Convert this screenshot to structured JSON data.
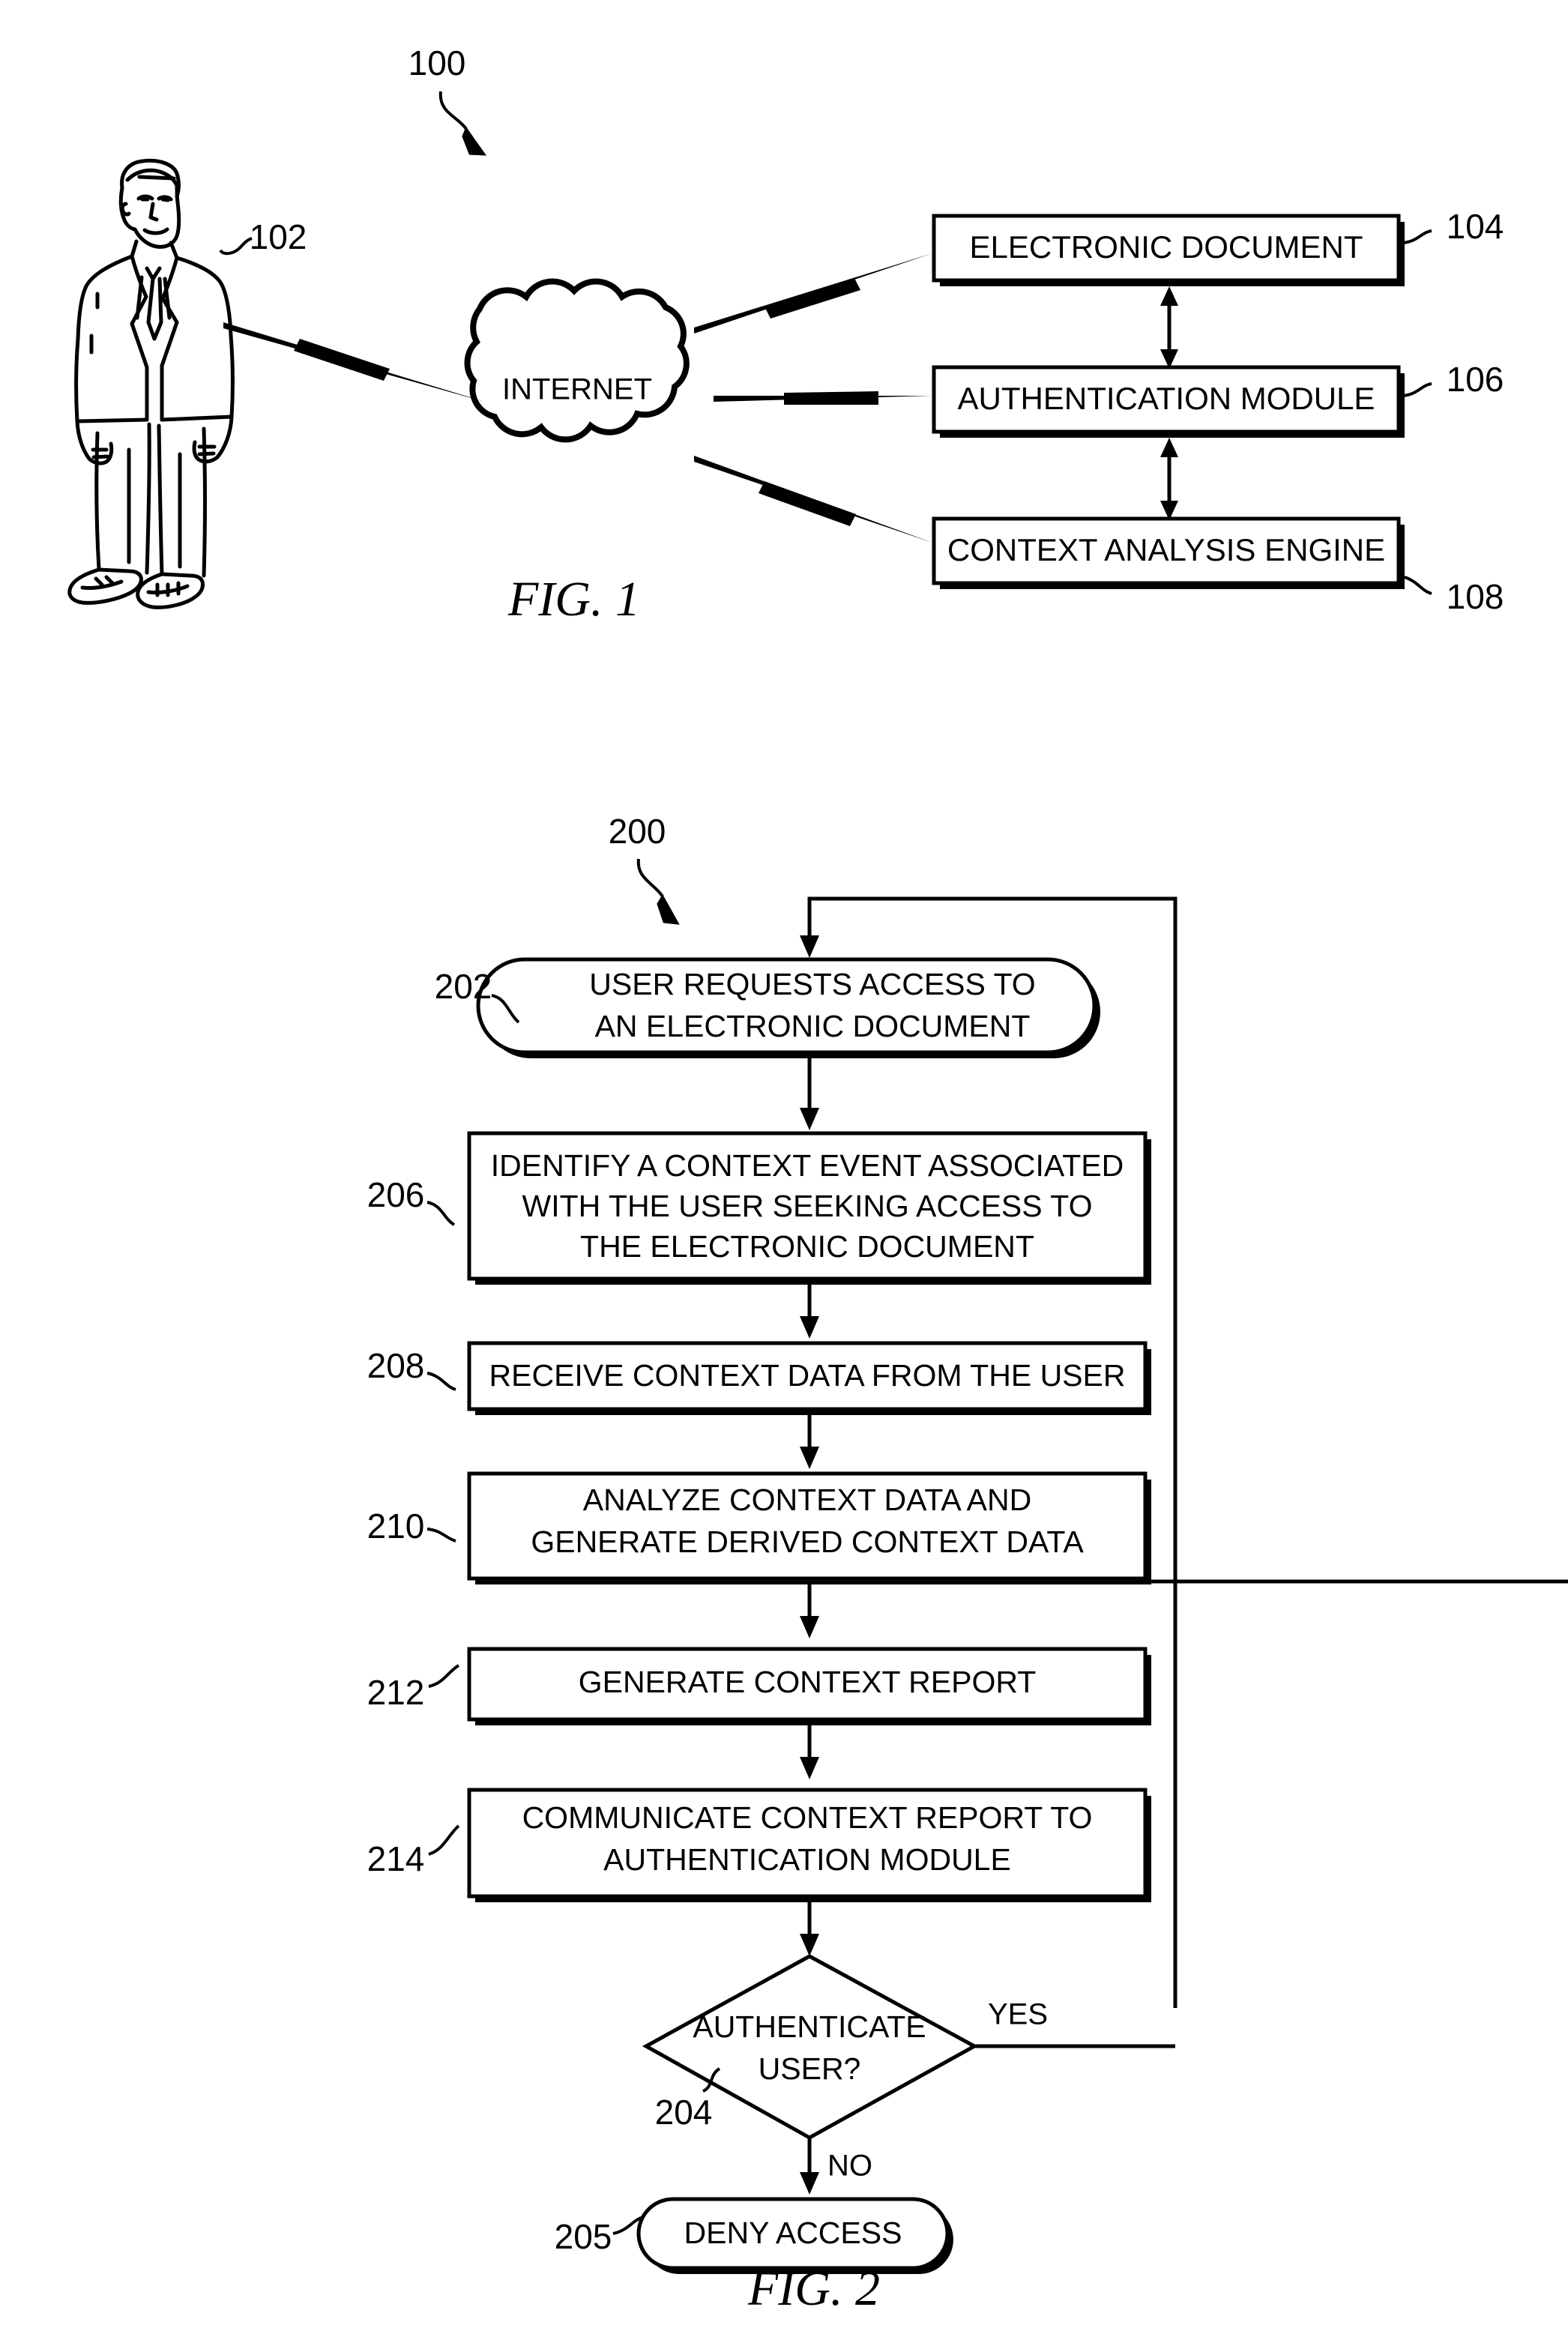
{
  "figure1": {
    "caption": "FIG. 1",
    "ref_system": "100",
    "ref_user": "102",
    "cloud_label": "INTERNET",
    "boxes": [
      {
        "label": "ELECTRONIC DOCUMENT",
        "ref": "104"
      },
      {
        "label": "AUTHENTICATION MODULE",
        "ref": "106"
      },
      {
        "label": "CONTEXT ANALYSIS ENGINE",
        "ref": "108"
      }
    ]
  },
  "figure2": {
    "caption": "FIG. 2",
    "ref_process": "200",
    "steps": [
      {
        "ref": "202",
        "shape": "terminator",
        "lines": [
          "USER REQUESTS ACCESS TO",
          "AN ELECTRONIC DOCUMENT"
        ]
      },
      {
        "ref": "206",
        "shape": "process",
        "lines": [
          "IDENTIFY A CONTEXT EVENT ASSOCIATED",
          "WITH THE USER SEEKING ACCESS TO",
          "THE ELECTRONIC DOCUMENT"
        ]
      },
      {
        "ref": "208",
        "shape": "process",
        "lines": [
          "RECEIVE CONTEXT DATA FROM THE USER"
        ]
      },
      {
        "ref": "210",
        "shape": "process",
        "lines": [
          "ANALYZE CONTEXT DATA AND",
          "GENERATE DERIVED CONTEXT DATA"
        ]
      },
      {
        "ref": "212",
        "shape": "process",
        "lines": [
          "GENERATE CONTEXT REPORT"
        ]
      },
      {
        "ref": "214",
        "shape": "process",
        "lines": [
          "COMMUNICATE CONTEXT REPORT TO",
          "AUTHENTICATION MODULE"
        ]
      },
      {
        "ref": "204",
        "shape": "decision",
        "lines": [
          "AUTHENTICATE",
          "USER?"
        ]
      },
      {
        "ref": "205",
        "shape": "terminator",
        "lines": [
          "DENY ACCESS"
        ]
      }
    ],
    "branch_yes": "YES",
    "branch_no": "NO"
  },
  "colors": {
    "ink": "#000000",
    "paper": "#ffffff"
  }
}
